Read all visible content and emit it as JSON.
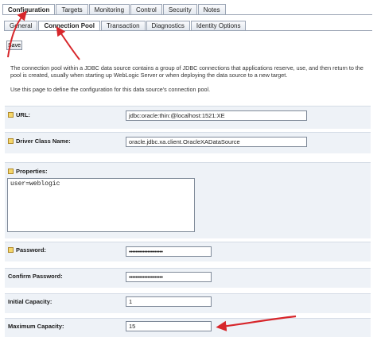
{
  "tabs": [
    "Configuration",
    "Targets",
    "Monitoring",
    "Control",
    "Security",
    "Notes"
  ],
  "subtabs": [
    "General",
    "Connection Pool",
    "Transaction",
    "Diagnostics",
    "Identity Options"
  ],
  "save_label": "Save",
  "description": {
    "line1": "The connection pool within a JDBC data source contains a group of JDBC connections that applications reserve, use, and then return to the",
    "line2": "pool is created, usually when starting up WebLogic Server or when deploying the data source to a new target.",
    "line3": "Use this page to define the configuration for this data source's connection pool."
  },
  "fields": {
    "url": {
      "label": "URL:",
      "value": "jdbc:oracle:thin:@localhost:1521:XE"
    },
    "driver": {
      "label": "Driver Class Name:",
      "value": "oracle.jdbc.xa.client.OracleXADataSource"
    },
    "properties": {
      "label": "Properties:",
      "value": "user=weblogic"
    },
    "password": {
      "label": "Password:",
      "value": "••••••••••••••••••••"
    },
    "confirm_password": {
      "label": "Confirm Password:",
      "value": "••••••••••••••••••••"
    },
    "initial_capacity": {
      "label": "Initial Capacity:",
      "value": "1"
    },
    "maximum_capacity": {
      "label": "Maximum Capacity:",
      "value": "15"
    }
  },
  "colors": {
    "annotation_arrow": "#d7262b",
    "field_background": "#eef2f7"
  },
  "icons": {
    "field_icon": "lock-icon"
  }
}
